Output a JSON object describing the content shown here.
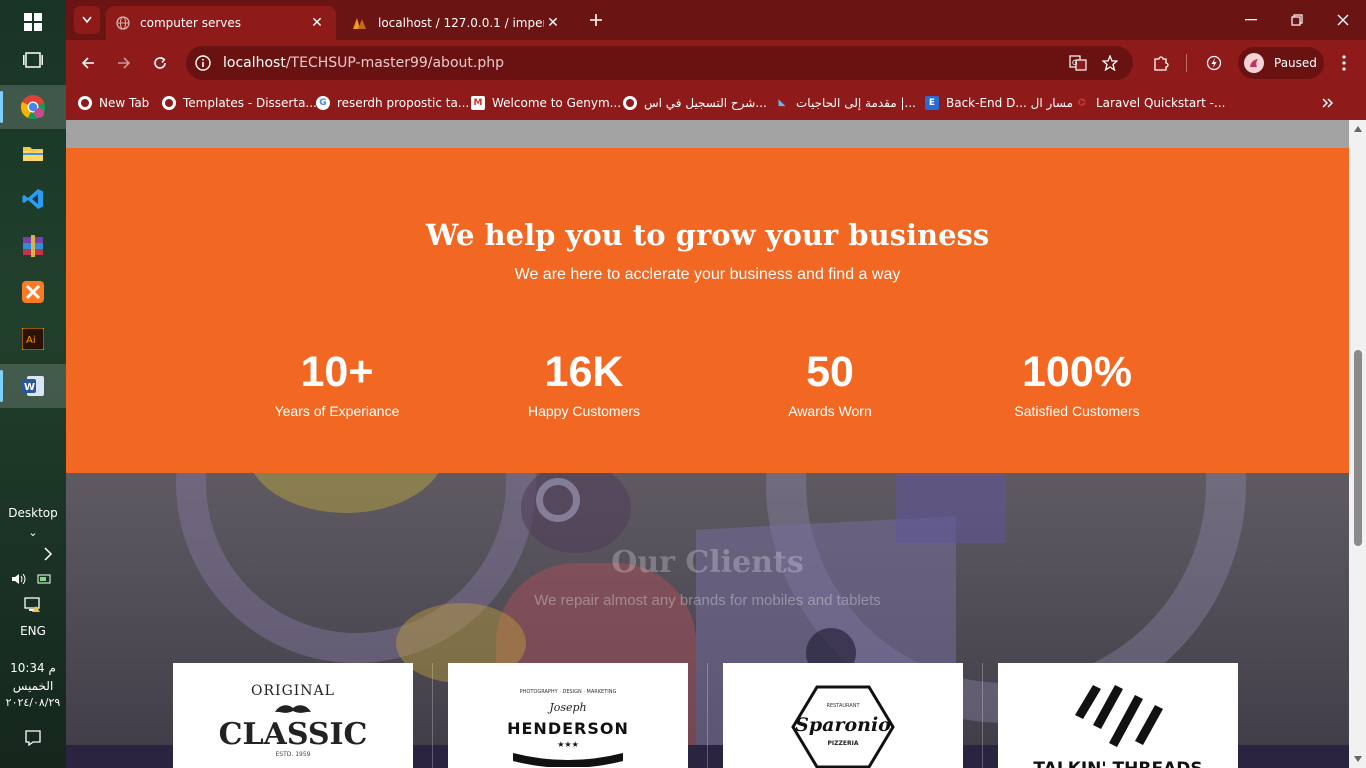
{
  "taskbar": {
    "desktop_label": "Desktop",
    "language": "ENG",
    "time": "10:34 م",
    "day": "الخميس",
    "date": "٢٠٢٤/٠٨/٢٩"
  },
  "browser": {
    "tabs": [
      {
        "title": "computer serves",
        "active": true
      },
      {
        "title": "localhost / 127.0.0.1 / imperial_",
        "active": false
      }
    ],
    "url_host": "localhost",
    "url_path": "/TECHSUP-master99/about.php",
    "profile_status": "Paused",
    "bookmarks": [
      {
        "label": "New Tab"
      },
      {
        "label": "Templates - Disserta..."
      },
      {
        "label": "reserdh propostic ta..."
      },
      {
        "label": "Welcome to Genym..."
      },
      {
        "label": "شرح التسجيل في اس..."
      },
      {
        "label": "مقدمة إلى الحاجيات |..."
      },
      {
        "label": "Back-End D... مسار ال"
      },
      {
        "label": "Laravel Quickstart -..."
      }
    ]
  },
  "page": {
    "stats": {
      "heading": "We help you to grow your business",
      "subheading": "We are here to acclerate your business and find a way",
      "items": [
        {
          "value": "10+",
          "label": "Years of Experiance"
        },
        {
          "value": "16K",
          "label": "Happy Customers"
        },
        {
          "value": "50",
          "label": "Awards Worn"
        },
        {
          "value": "100%",
          "label": "Satisfied Customers"
        }
      ]
    },
    "clients": {
      "heading": "Our Clients",
      "subheading": "We repair almost any brands for mobiles and tablets",
      "logos": [
        {
          "top": "ORIGINAL",
          "main": "CLASSIC",
          "est": "ESTD. 1959"
        },
        {
          "top": "PHOTOGRAPHY · DESIGN · MARKETING",
          "script": "Joseph",
          "main": "HENDERSON"
        },
        {
          "top": "RESTAURANT",
          "main": "Sparonio",
          "bottom": "PIZZERIA"
        },
        {
          "main": "TALKIN' THREADS"
        }
      ]
    }
  }
}
